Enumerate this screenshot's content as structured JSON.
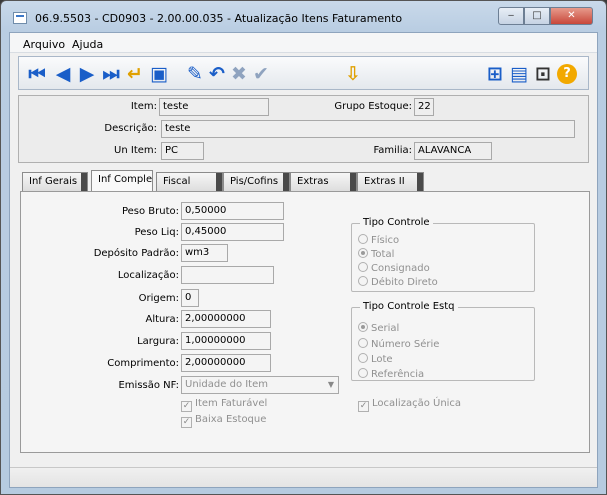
{
  "window": {
    "title": "06.9.5503 - CD0903 - 2.00.00.035 - Atualização Itens Faturamento",
    "min_icon": "minimize-icon",
    "max_icon": "maximize-icon",
    "close_icon": "close-icon",
    "min_glyph": "‒",
    "max_glyph": "□",
    "close_glyph": "✕"
  },
  "menu": {
    "arquivo": "Arquivo",
    "ajuda": "Ajuda"
  },
  "toolbar": {
    "first": "⏮",
    "prev": "◀",
    "next": "▶",
    "last": "⏭",
    "goto": "↵",
    "search": "▣",
    "edit": "✎",
    "undo": "↶",
    "delete": "✖",
    "confirm": "✔",
    "import": "⇩",
    "tree": "⊞",
    "print": "▤",
    "exit": "⊡",
    "help": "?"
  },
  "header": {
    "item_label": "Item:",
    "item_value": "teste",
    "grupo_label": "Grupo Estoque:",
    "grupo_value": "22",
    "descricao_label": "Descrição:",
    "descricao_value": "teste",
    "un_label": "Un Item:",
    "un_value": "PC",
    "familia_label": "Familia:",
    "familia_value": "ALAVANCA"
  },
  "tabs": [
    "Inf Gerais",
    "Inf Compler",
    "Fiscal",
    "Pis/Cofins",
    "Extras",
    "Extras II"
  ],
  "active_tab": "Inf Compler",
  "form": {
    "peso_bruto_label": "Peso Bruto:",
    "peso_bruto": "0,50000",
    "peso_liq_label": "Peso Liq:",
    "peso_liq": "0,45000",
    "deposito_label": "Depósito Padrão:",
    "deposito": "wm3",
    "localizacao_label": "Localização:",
    "localizacao": "",
    "origem_label": "Origem:",
    "origem": "0",
    "altura_label": "Altura:",
    "altura": "2,00000000",
    "largura_label": "Largura:",
    "largura": "1,00000000",
    "comprimento_label": "Comprimento:",
    "comprimento": "2,00000000",
    "emissao_label": "Emissão NF:",
    "emissao": "Unidade do Item",
    "item_faturavel": "Item Faturável",
    "baixa_estoque": "Baixa Estoque",
    "localizacao_unica": "Localização Única"
  },
  "tipo_controle": {
    "title": "Tipo Controle",
    "options": [
      "Físico",
      "Total",
      "Consignado",
      "Débito Direto"
    ],
    "selected": "Total"
  },
  "tipo_controle_estq": {
    "title": "Tipo Controle Estq",
    "options": [
      "Serial",
      "Número Série",
      "Lote",
      "Referência"
    ],
    "selected": "Serial"
  }
}
